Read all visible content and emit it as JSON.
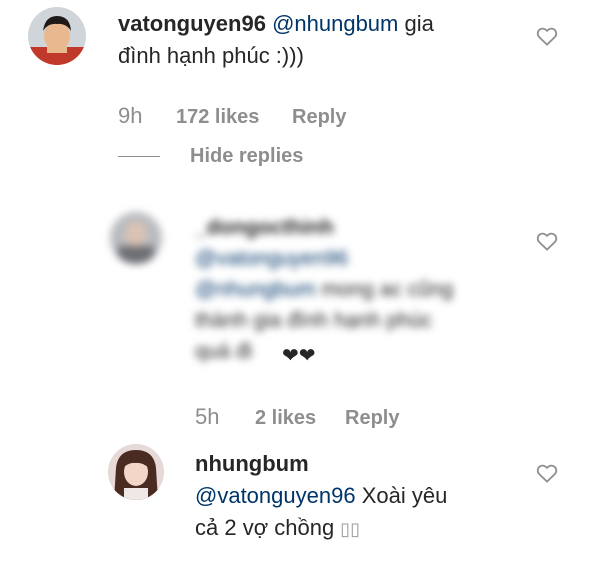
{
  "comments": [
    {
      "username": "vatonguyen96",
      "mention": "@nhungbum",
      "text_line1": " gia",
      "text_line2": "đình hạnh phúc :)))",
      "time": "9h",
      "likes": "172 likes",
      "reply": "Reply"
    }
  ],
  "replies_toggle": "Hide replies",
  "replies": [
    {
      "username": "_dongocthinh",
      "mention1": "@vatonguyen96",
      "mention2": "@nhungbum",
      "text_line1": " mong ac cũng",
      "text_line2": "thành gia đình hạnh phúc",
      "text_line3": "quá đi",
      "hearts": "❤❤",
      "time": "5h",
      "likes": "2 likes",
      "reply": "Reply"
    },
    {
      "username": "nhungbum",
      "mention": "@vatonguyen96",
      "text_line1": " Xoài yêu",
      "text_line2": "cả 2 vợ chồng ",
      "emoji": "▯▯"
    }
  ],
  "icons": {
    "like": "heart-outline-icon"
  }
}
